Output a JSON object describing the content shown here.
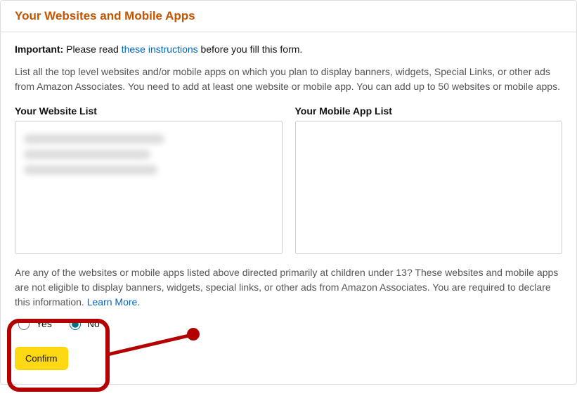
{
  "panel": {
    "title": "Your Websites and Mobile Apps",
    "importantLabel": "Important:",
    "importantPre": " Please read ",
    "importantLink": "these instructions",
    "importantPost": " before you fill this form.",
    "description": "List all the top level websites and/or mobile apps on which you plan to display banners, widgets, Special Links, or other ads from Amazon Associates. You need to add at least one website or mobile app. You can add up to 50 websites or mobile apps.",
    "websiteListLabel": "Your Website List",
    "mobileListLabel": "Your Mobile App List",
    "question": "Are any of the websites or mobile apps listed above directed primarily at children under 13? These websites and mobile apps are not eligible to display banners, widgets, special links, or other ads from Amazon Associates. You are required to declare this information. ",
    "learnMore": "Learn More",
    "period": ".",
    "radioYes": "Yes",
    "radioNo": "No",
    "confirmLabel": "Confirm"
  }
}
